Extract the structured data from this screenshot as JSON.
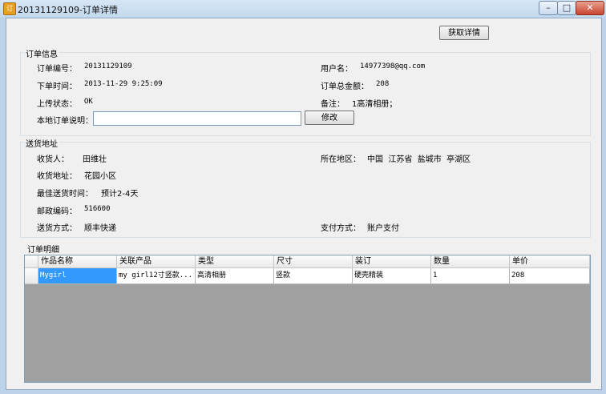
{
  "window": {
    "title": "20131129109-订单详情",
    "icon": "app-icon",
    "icon_glyph": "订"
  },
  "window_controls": {
    "minimize": "–",
    "maximize": "□",
    "close": "✕"
  },
  "toolbar": {
    "fetch_details_label": "获取详情"
  },
  "order_info": {
    "group_title": "订单信息",
    "order_no_label": "订单编号：",
    "order_no": "20131129109",
    "username_label": "用户名：",
    "username": "14977398@qq.com",
    "order_time_label": "下单时间：",
    "order_time": "2013-11-29 9:25:09",
    "total_label": "订单总金额：",
    "total": "208",
    "upload_status_label": "上传状态：",
    "upload_status": "OK",
    "remark_label": "备注：",
    "remark": "1高清相册；",
    "local_note_label": "本地订单说明：",
    "local_note_value": "",
    "modify_label": "修改"
  },
  "address": {
    "group_title": "送货地址",
    "recipient_label": "收货人：",
    "recipient": "田维壮",
    "region_label": "所在地区：",
    "region": "中国  江苏省  盐城市  亭湖区",
    "address_label": "收货地址：",
    "address": "花园小区",
    "delivery_time_label": "最佳送货时间：",
    "delivery_time": "预计2-4天",
    "postcode_label": "邮政编码：",
    "postcode": "516600",
    "shipping_label": "送货方式：",
    "shipping": "顺丰快递",
    "payment_label": "支付方式：",
    "payment": "账户支付"
  },
  "details": {
    "group_title": "订单明细",
    "columns": [
      "作品名称",
      "关联产品",
      "类型",
      "尺寸",
      "装订",
      "数量",
      "单价"
    ],
    "rows": [
      [
        "Mygirl",
        "my girl12寸竖款...",
        "高清相册",
        "竖款",
        "硬壳精装",
        "1",
        "208"
      ]
    ]
  }
}
